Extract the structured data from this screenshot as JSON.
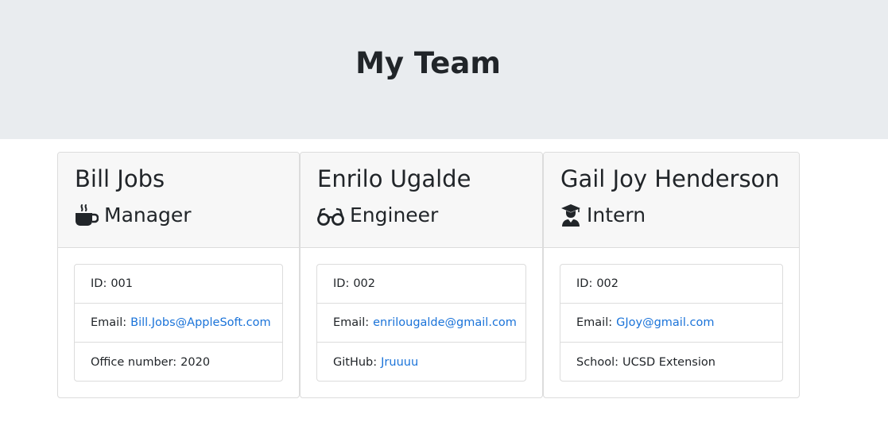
{
  "header": {
    "title": "My Team"
  },
  "colors": {
    "jumbotron": "#e9ecef",
    "link": "#1a73d9",
    "card_header": "#f7f7f7"
  },
  "cards": [
    {
      "name": "Bill Jobs",
      "role": "Manager",
      "role_icon": "coffee-mug-icon",
      "id_label": "ID:",
      "id": "001",
      "email_label": "Email:",
      "email": "Bill.Jobs@AppleSoft.com",
      "extra_label": "Office number:",
      "extra_value": "2020"
    },
    {
      "name": "Enrilo Ugalde",
      "role": "Engineer",
      "role_icon": "glasses-icon",
      "id_label": "ID:",
      "id": "002",
      "email_label": "Email:",
      "email": "enrilougalde@gmail.com",
      "extra_label": "GitHub:",
      "extra_value": "Jruuuu"
    },
    {
      "name": "Gail Joy Henderson",
      "role": "Intern",
      "role_icon": "graduate-icon",
      "id_label": "ID:",
      "id": "002",
      "email_label": "Email:",
      "email": "GJoy@gmail.com",
      "extra_label": "School:",
      "extra_value": "UCSD Extension"
    }
  ]
}
